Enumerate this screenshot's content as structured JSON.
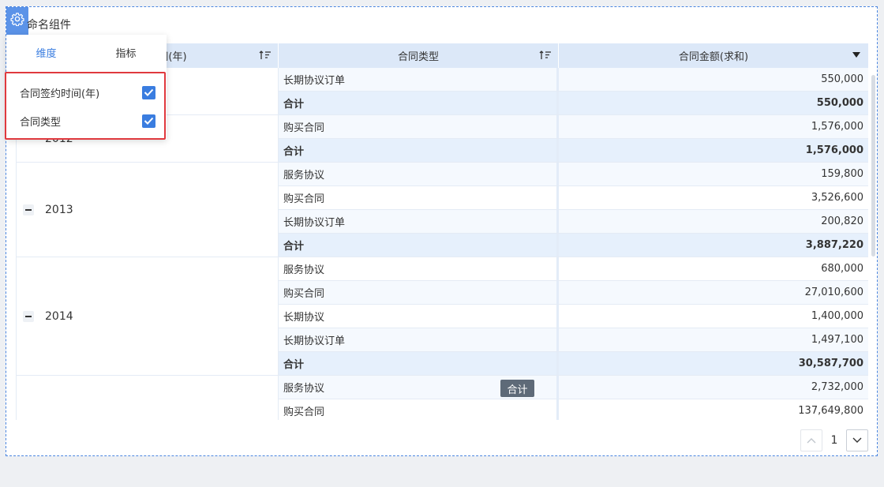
{
  "widget": {
    "title": "命名组件"
  },
  "table": {
    "headers": {
      "year": "合同签约时间(年)",
      "type": "合同类型",
      "amount": "合同金额(求和)"
    },
    "year_labels": {
      "y2012": "2012",
      "y2013": "2013",
      "y2014": "2014"
    },
    "rows": [
      {
        "type": "长期协议订单",
        "amount": "550,000",
        "kind": "odd"
      },
      {
        "type": "合计",
        "amount": "550,000",
        "kind": "total"
      },
      {
        "type": "购买合同",
        "amount": "1,576,000",
        "kind": "odd"
      },
      {
        "type": "合计",
        "amount": "1,576,000",
        "kind": "total"
      },
      {
        "type": "服务协议",
        "amount": "159,800",
        "kind": "odd"
      },
      {
        "type": "购买合同",
        "amount": "3,526,600",
        "kind": "even"
      },
      {
        "type": "长期协议订单",
        "amount": "200,820",
        "kind": "odd"
      },
      {
        "type": "合计",
        "amount": "3,887,220",
        "kind": "total"
      },
      {
        "type": "服务协议",
        "amount": "680,000",
        "kind": "even"
      },
      {
        "type": "购买合同",
        "amount": "27,010,600",
        "kind": "odd"
      },
      {
        "type": "长期协议",
        "amount": "1,400,000",
        "kind": "even"
      },
      {
        "type": "长期协议订单",
        "amount": "1,497,100",
        "kind": "odd"
      },
      {
        "type": "合计",
        "amount": "30,587,700",
        "kind": "total"
      },
      {
        "type": "服务协议",
        "amount": "2,732,000",
        "kind": "odd"
      },
      {
        "type": "购买合同",
        "amount": "137,649,800",
        "kind": "even"
      }
    ]
  },
  "tooltip": {
    "text": "合计"
  },
  "pager": {
    "page": "1"
  },
  "popup": {
    "tabs": [
      "维度",
      "指标"
    ],
    "options": [
      {
        "label": "合同签约时间(年)",
        "checked": true
      },
      {
        "label": "合同类型",
        "checked": true
      }
    ]
  },
  "colors": {
    "accent": "#3a7de0",
    "header_bg": "#dce8f8",
    "total_bg": "#e6f0fc",
    "highlight_border": "#e0393e"
  }
}
